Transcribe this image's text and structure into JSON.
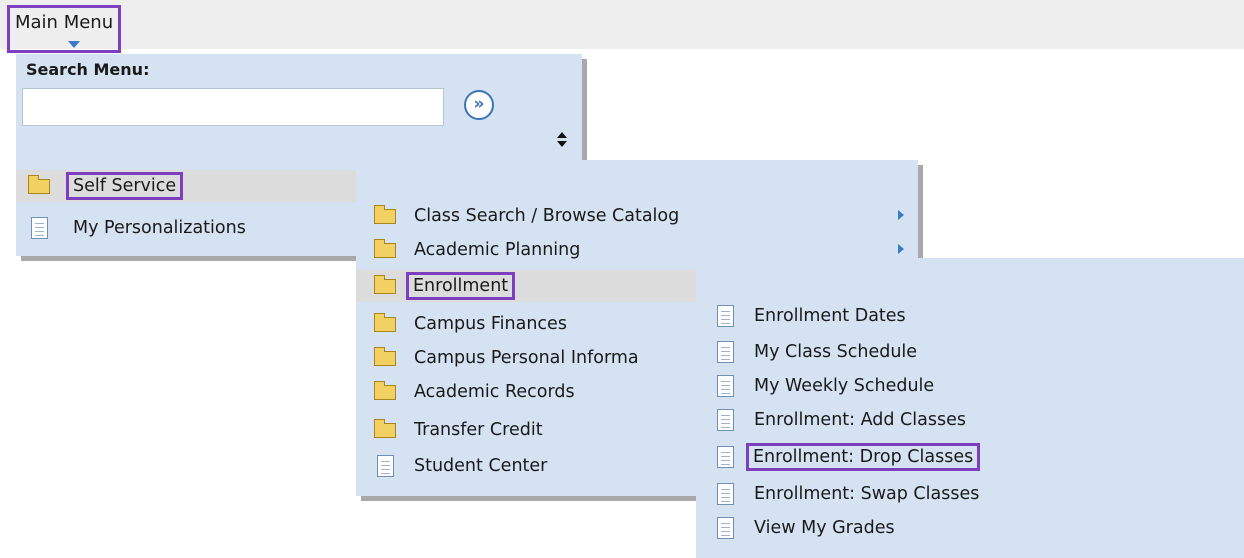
{
  "header": {
    "main_menu_label": "Main Menu"
  },
  "search": {
    "label": "Search Menu:",
    "value": "",
    "go_symbol": "»"
  },
  "menu_level1": {
    "items": [
      {
        "label": "Self Service",
        "icon": "folder-icon"
      },
      {
        "label": "My Personalizations",
        "icon": "page-icon"
      }
    ]
  },
  "menu_level2": {
    "items": [
      {
        "label": "Class Search / Browse Catalog",
        "icon": "folder-icon",
        "has_submenu": true
      },
      {
        "label": "Academic Planning",
        "icon": "folder-icon",
        "has_submenu": true
      },
      {
        "label": "Enrollment",
        "icon": "folder-icon"
      },
      {
        "label": "Campus Finances",
        "icon": "folder-icon"
      },
      {
        "label": "Campus Personal Informa",
        "icon": "folder-icon"
      },
      {
        "label": "Academic Records",
        "icon": "folder-icon"
      },
      {
        "label": "Transfer Credit",
        "icon": "folder-icon"
      },
      {
        "label": "Student Center",
        "icon": "page-icon"
      }
    ]
  },
  "menu_level3": {
    "items": [
      {
        "label": "Enrollment Dates",
        "icon": "page-icon"
      },
      {
        "label": "My Class Schedule",
        "icon": "page-icon"
      },
      {
        "label": "My Weekly Schedule",
        "icon": "page-icon"
      },
      {
        "label": "Enrollment: Add Classes",
        "icon": "page-icon"
      },
      {
        "label": "Enrollment: Drop Classes",
        "icon": "page-icon"
      },
      {
        "label": "Enrollment: Swap Classes",
        "icon": "page-icon"
      },
      {
        "label": "View My Grades",
        "icon": "page-icon"
      }
    ]
  },
  "colors": {
    "highlight": "#7b3fbf",
    "panel": "#d4e2f1",
    "selected_row": "#dcdcdc"
  }
}
